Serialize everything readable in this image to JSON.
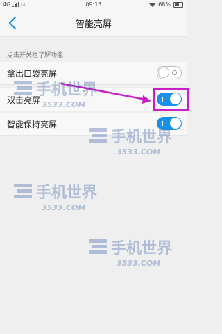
{
  "status_bar": {
    "network": "4G",
    "time": "09:13",
    "battery": "68%"
  },
  "header": {
    "back_icon": "chevron-left-icon",
    "title": "智能亮屏"
  },
  "section_hint": "点击开关栏了解功能",
  "settings": [
    {
      "label": "拿出口袋亮屏",
      "enabled": false
    },
    {
      "label": "双击亮屏",
      "enabled": true
    },
    {
      "label": "智能保持亮屏",
      "enabled": true
    }
  ],
  "watermark": {
    "brand": "手机世界",
    "domain": "3533.COM"
  },
  "colors": {
    "toggle_on": "#1c8fe6",
    "annotation": "#c81fc6",
    "back_icon": "#1c8fe6"
  }
}
